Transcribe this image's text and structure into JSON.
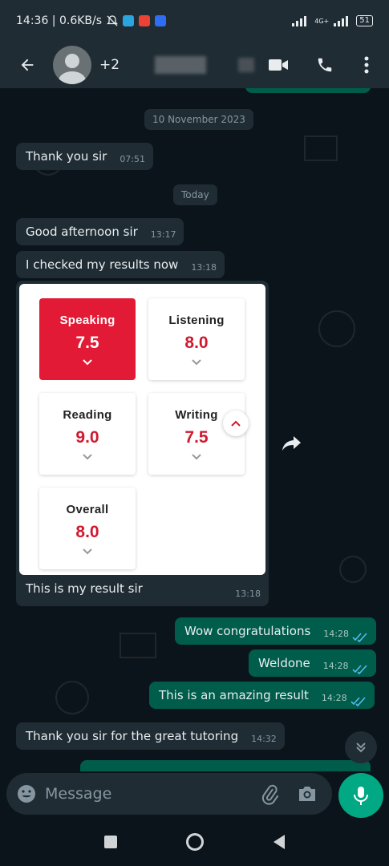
{
  "status_bar": {
    "time_speed": "14:36 | 0.6KB/s",
    "network": "4G+",
    "battery": "51"
  },
  "header": {
    "participants_more": "+2"
  },
  "messages": {
    "date_1": "10 November 2023",
    "m1": {
      "text": "Thank you sir",
      "time": "07:51"
    },
    "date_2": "Today",
    "m2": {
      "text": "Good afternoon sir",
      "time": "13:17"
    },
    "m3": {
      "text": "I checked my results now",
      "time": "13:18"
    },
    "image_message": {
      "caption": "This is my result sir",
      "time": "13:18",
      "scores": [
        {
          "label": "Speaking",
          "value": "7.5"
        },
        {
          "label": "Listening",
          "value": "8.0"
        },
        {
          "label": "Reading",
          "value": "9.0"
        },
        {
          "label": "Writing",
          "value": "7.5"
        },
        {
          "label": "Overall",
          "value": "8.0"
        }
      ]
    },
    "m4": {
      "text": "Wow congratulations",
      "time": "14:28"
    },
    "m5": {
      "text": "Weldone",
      "time": "14:28"
    },
    "m6": {
      "text": "This is an amazing result",
      "time": "14:28"
    },
    "m7": {
      "text": "Thank you sir for the great tutoring",
      "time": "14:32"
    }
  },
  "composer": {
    "placeholder": "Message"
  },
  "colors": {
    "background": "#0b141a",
    "bar": "#1f2c34",
    "incoming": "#1f2c34",
    "outgoing": "#005c4b",
    "accent": "#00a884",
    "score_red": "#e21a35",
    "read_ticks": "#53bdeb"
  }
}
